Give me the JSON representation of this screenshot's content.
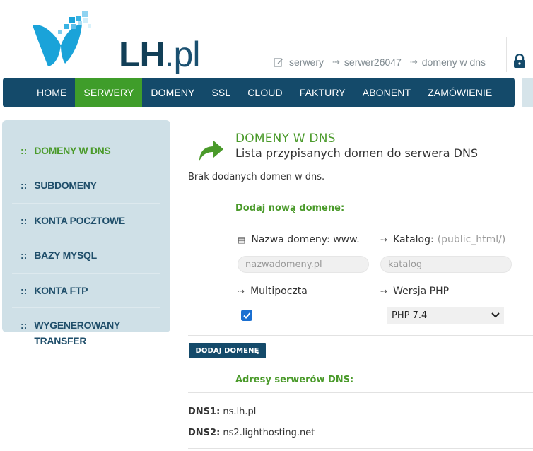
{
  "header": {
    "logo_text": "LH",
    "logo_suffix": ".pl",
    "breadcrumb": [
      "serwery",
      "serwer26047",
      "domeny w dns"
    ]
  },
  "nav": {
    "items": [
      {
        "label": "HOME"
      },
      {
        "label": "SERWERY",
        "active": true
      },
      {
        "label": "DOMENY"
      },
      {
        "label": "SSL"
      },
      {
        "label": "CLOUD"
      },
      {
        "label": "FAKTURY"
      },
      {
        "label": "ABONENT"
      },
      {
        "label": "ZAMÓWIENIE"
      }
    ]
  },
  "sidebar": {
    "bullet": "::",
    "items": [
      {
        "label": "DOMENY W DNS",
        "active": true
      },
      {
        "label": "SUBDOMENY"
      },
      {
        "label": "KONTA POCZTOWE"
      },
      {
        "label": "BAZY MYSQL"
      },
      {
        "label": "KONTA FTP"
      },
      {
        "label": "WYGENEROWANY TRANSFER"
      }
    ]
  },
  "main": {
    "title": "DOMENY W DNS",
    "subtitle": "Lista przypisanych domen do serwera DNS",
    "empty_message": "Brak dodanych domen w dns.",
    "add_section_title": "Dodaj nową domene:",
    "form": {
      "domain_label": "Nazwa domeny: www.",
      "domain_placeholder": "nazwadomeny.pl",
      "dir_label": "Katalog:",
      "dir_hint": "(public_html/)",
      "dir_placeholder": "katalog",
      "multimail_label": "Multipoczta",
      "multimail_checked": true,
      "php_label": "Wersja PHP",
      "php_selected": "PHP 7.4",
      "submit_label": "DODAJ DOMENĘ"
    },
    "dns_section_title": "Adresy serwerów DNS:",
    "dns": [
      {
        "key": "DNS1:",
        "value": "ns.lh.pl"
      },
      {
        "key": "DNS2:",
        "value": "ns2.lighthosting.net"
      }
    ]
  },
  "colors": {
    "brand_dark": "#144a6a",
    "accent_green": "#4a9a2a",
    "nav_active": "#3f9d2a",
    "sidebar_bg": "#cfe0e7"
  }
}
